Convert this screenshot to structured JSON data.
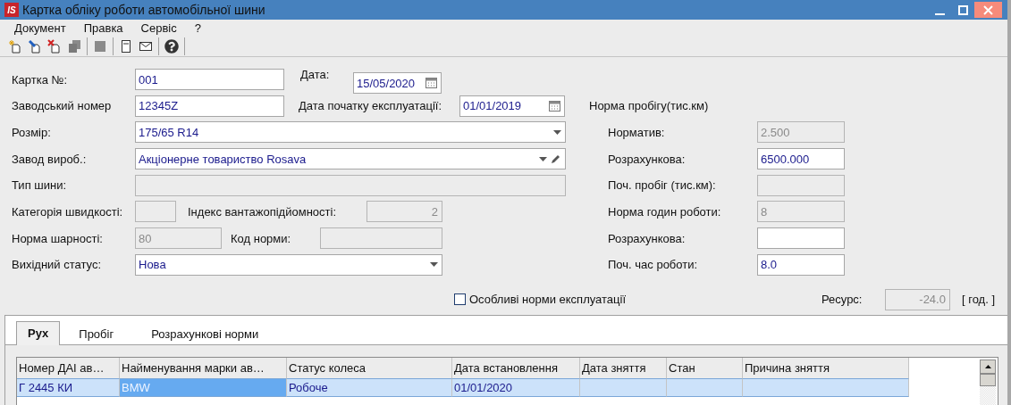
{
  "window": {
    "logo": "IS",
    "title": "Картка обліку роботи автомобільної шини"
  },
  "menu": [
    "Документ",
    "Правка",
    "Сервіс",
    "?"
  ],
  "toolbar": [
    {
      "buttons": [
        {
          "kind": "new",
          "disabled": false
        },
        {
          "kind": "edit",
          "disabled": false
        },
        {
          "kind": "delete",
          "disabled": false
        },
        {
          "kind": "copy",
          "disabled": true
        }
      ]
    },
    {
      "buttons": [
        {
          "kind": "save",
          "disabled": true
        }
      ]
    },
    {
      "buttons": [
        {
          "kind": "form",
          "disabled": false
        },
        {
          "kind": "mail",
          "disabled": false
        }
      ]
    },
    {
      "buttons": [
        {
          "kind": "help",
          "disabled": false
        }
      ]
    }
  ],
  "form": {
    "card_no": {
      "label": "Картка №:",
      "value": "001",
      "disabled": false
    },
    "date": {
      "label": "Дата:",
      "value": "15/05/2020",
      "kind": "date",
      "disabled": false
    },
    "serial": {
      "label": "Заводський номер",
      "value": "12345Z",
      "disabled": false
    },
    "start_date": {
      "label": "Дата початку експлуатації:",
      "value": "01/01/2019",
      "kind": "date",
      "disabled": false
    },
    "size": {
      "label": "Розмір:",
      "value": "175/65 R14",
      "kind": "combo",
      "disabled": false
    },
    "manufacturer": {
      "label": "Завод вироб.:",
      "value": "Акціонерне товариство Rosava",
      "kind": "combo_edit",
      "disabled": false
    },
    "tire_type": {
      "label": "Тип шини:",
      "disabled": true
    },
    "speed_category": {
      "label": "Категорія швидкості:",
      "disabled": true
    },
    "load_index": {
      "label": "Індекс вантажопідйомності:",
      "value": "2",
      "disabled": true
    },
    "pressure_norm": {
      "label": "Норма шарності:",
      "value": "80",
      "disabled": true
    },
    "norm_code": {
      "label": "Код норми:",
      "disabled": true
    },
    "initial_status": {
      "label": "Вихідний статус:",
      "value": "Нова",
      "kind": "combo",
      "disabled": false
    }
  },
  "norms": {
    "title": "Норма пробігу(тис.км)",
    "fields": [
      {
        "label": "Норматив:",
        "value": "2.500",
        "disabled": true
      },
      {
        "label": "Розрахункова:",
        "value": "6500.000",
        "disabled": false
      },
      {
        "label": "Поч. пробіг (тис.км):",
        "disabled": true
      },
      {
        "label": "Норма годин роботи:",
        "value": "8",
        "disabled": true
      },
      {
        "label": "Розрахункова:",
        "disabled": false
      },
      {
        "label": "Поч. час роботи:",
        "value": "8.0",
        "disabled": false
      }
    ]
  },
  "special_norms": {
    "label": "Особливі норми експлуатації",
    "checked": false
  },
  "resource": {
    "label": "Ресурс:",
    "value": "-24.0",
    "disabled": true,
    "unit": "[ год. ]"
  },
  "tabs": [
    {
      "label": "Рух",
      "selected": true
    },
    {
      "label": "Пробіг",
      "selected": false
    },
    {
      "label": "Розрахункові норми",
      "selected": false
    }
  ],
  "table": {
    "columns": [
      "Номер ДАІ ав…",
      "Найменування марки ав…",
      "Статус колеса",
      "Дата встановлення",
      "Дата зняття",
      "Стан",
      "Причина зняття"
    ],
    "rows": [
      {
        "selected": true,
        "cells": [
          {
            "text": "Г 2445 КИ",
            "focused": false
          },
          {
            "text": "BMW",
            "focused": true
          },
          {
            "text": "Робоче",
            "focused": false
          },
          {
            "text": "01/01/2020",
            "focused": false
          },
          {
            "focused": false
          },
          {
            "focused": false
          },
          {
            "focused": false
          }
        ]
      }
    ]
  }
}
